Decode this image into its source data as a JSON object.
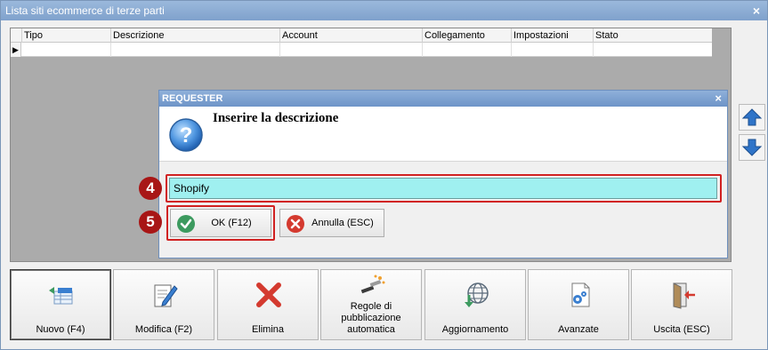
{
  "window": {
    "title": "Lista siti ecommerce di terze parti",
    "close_glyph": "×"
  },
  "grid": {
    "columns": [
      "Tipo",
      "Descrizione",
      "Account",
      "Collegamento",
      "Impostazioni",
      "Stato"
    ],
    "row_indicator": "▶"
  },
  "dialog": {
    "title": "REQUESTER",
    "close_glyph": "×",
    "prompt": "Inserire la descrizione",
    "input_value": "Shopify",
    "ok_label": "OK (F12)",
    "cancel_label": "Annulla (ESC)"
  },
  "annotations": {
    "input_step": "4",
    "ok_step": "5"
  },
  "toolbar": {
    "new_label": "Nuovo (F4)",
    "edit_label": "Modifica (F2)",
    "delete_label": "Elimina",
    "rules_label": "Regole di pubblicazione automatica",
    "update_label": "Aggiornamento",
    "advanced_label": "Avanzate",
    "exit_label": "Uscita (ESC)"
  },
  "icons": {
    "up": "arrow-up-icon",
    "down": "arrow-down-icon",
    "question": "question-icon",
    "ok": "check-icon",
    "cancel": "cancel-icon",
    "new": "add-row-icon",
    "edit": "edit-icon",
    "delete": "delete-icon",
    "rules": "magic-wand-icon",
    "update": "globe-download-icon",
    "advanced": "gear-document-icon",
    "exit": "exit-door-icon"
  },
  "colors": {
    "accent": "#3a7fd0",
    "highlight": "#d12121",
    "input_bg": "#9ff0f0",
    "delete": "#d43a2f",
    "ok": "#3c9a5f"
  }
}
